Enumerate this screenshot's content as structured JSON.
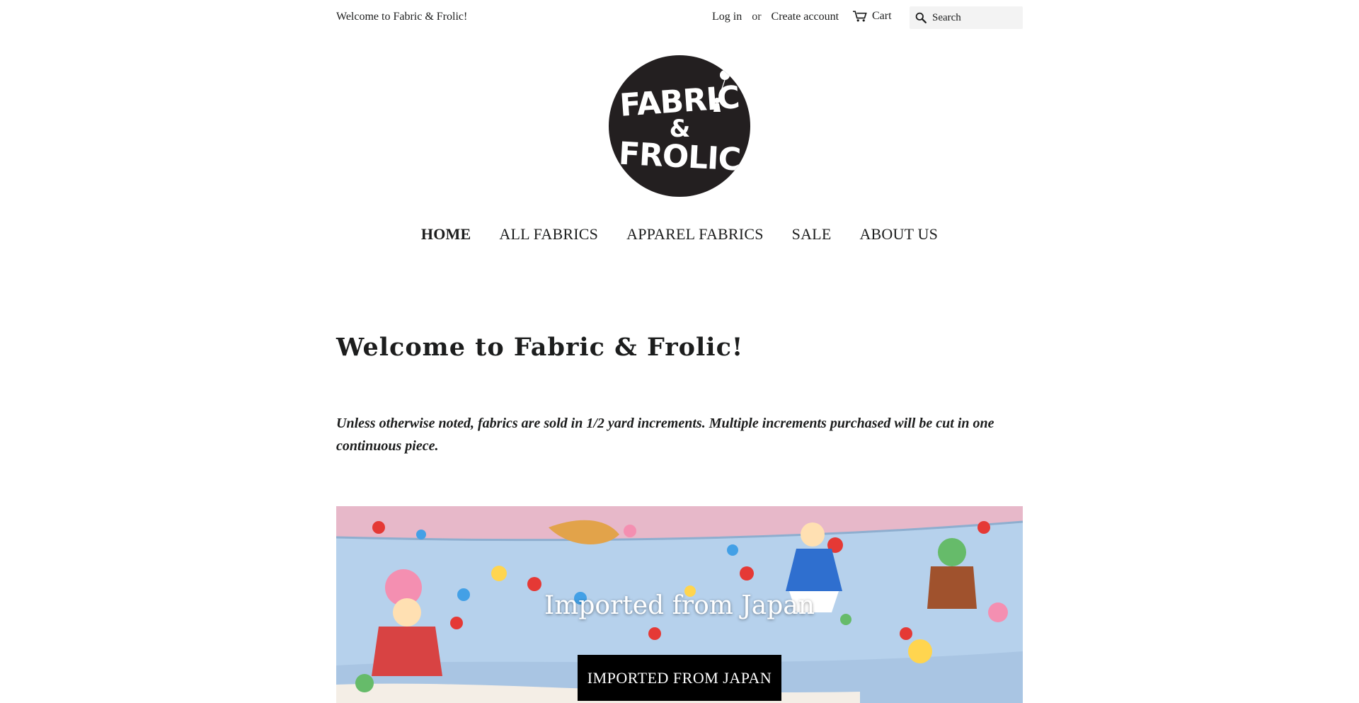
{
  "header": {
    "welcome": "Welcome to Fabric & Frolic!",
    "login_label": "Log in",
    "or_label": "or",
    "create_account_label": "Create account",
    "cart_label": "Cart",
    "search_placeholder": "Search"
  },
  "logo": {
    "alt": "Fabric & Frolic",
    "line1": "FABRIC",
    "line2": "&",
    "line3": "FROLIC"
  },
  "nav": {
    "items": [
      {
        "label": "HOME",
        "active": true
      },
      {
        "label": "ALL FABRICS",
        "active": false
      },
      {
        "label": "APPAREL FABRICS",
        "active": false
      },
      {
        "label": "SALE",
        "active": false
      },
      {
        "label": "ABOUT US",
        "active": false
      }
    ]
  },
  "main": {
    "title": "Welcome to Fabric & Frolic!",
    "notice": "Unless otherwise noted, fabrics are sold in 1/2 yard increments. Multiple increments purchased will be cut in one continuous piece."
  },
  "hero": {
    "title": "Imported from Japan",
    "button_label": "IMPORTED FROM JAPAN"
  },
  "colors": {
    "text": "#1c1d1d",
    "logo_bg": "#231f20",
    "search_bg": "#f3f3f3",
    "button_bg": "#000000",
    "fabric_blue": "#b6d1ec",
    "fabric_pink": "#e7b8c9"
  },
  "icons": {
    "cart": "cart-icon",
    "search": "search-icon"
  }
}
